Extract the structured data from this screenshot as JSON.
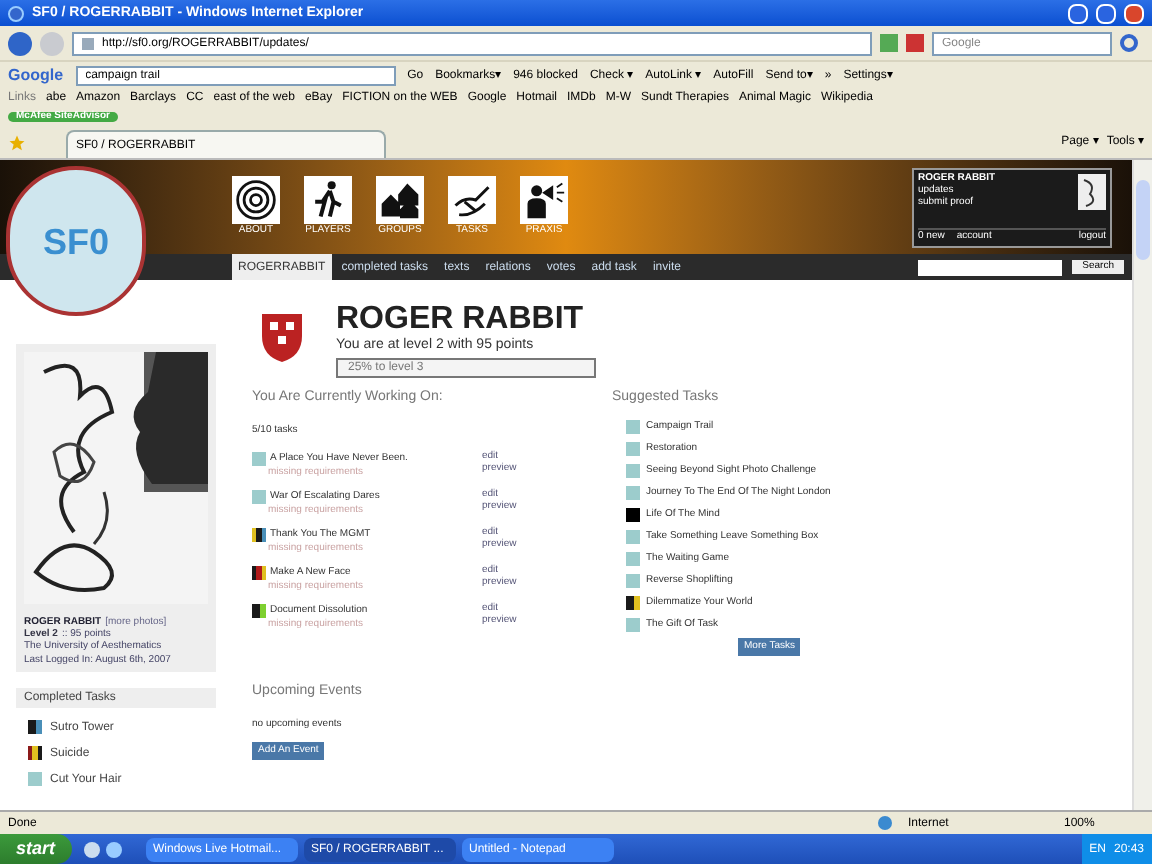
{
  "window": {
    "title": "SF0 / ROGERRABBIT - Windows Internet Explorer"
  },
  "address": {
    "url": "http://sf0.org/ROGERRABBIT/updates/",
    "search_placeholder": "Google"
  },
  "google_toolbar": {
    "brand": "Google",
    "query": "campaign trail",
    "go": "Go",
    "items": [
      "Bookmarks▾",
      "946 blocked",
      "Check ▾",
      "AutoLink ▾",
      "AutoFill",
      "Send to▾",
      "»",
      "Settings▾"
    ]
  },
  "links_bar": {
    "label": "Links",
    "links": [
      "abe",
      "Amazon",
      "Barclays",
      "CC",
      "east of the web",
      "eBay",
      "FICTION on the WEB",
      "Google",
      "Hotmail",
      "IMDb",
      "M-W",
      "Sundt Therapies",
      "Animal Magic",
      "Wikipedia"
    ]
  },
  "mcafee": {
    "label": "McAfee SiteAdvisor"
  },
  "tab": {
    "title": "SF0 / ROGERRABBIT"
  },
  "command_bar": {
    "items": [
      "Page ▾",
      "Tools ▾"
    ]
  },
  "site": {
    "logo": "SF0",
    "sections": [
      {
        "label": "ABOUT",
        "kind": "target"
      },
      {
        "label": "PLAYERS",
        "kind": "runner"
      },
      {
        "label": "GROUPS",
        "kind": "houses"
      },
      {
        "label": "TASKS",
        "kind": "hand"
      },
      {
        "label": "PRAXIS",
        "kind": "megaphone"
      }
    ],
    "user_box": {
      "name": "ROGER RABBIT",
      "links": [
        "updates",
        "submit proof"
      ],
      "messages": "0 new",
      "account": "account",
      "logout": "logout"
    },
    "nav": [
      {
        "label": "ROGERRABBIT",
        "selected": true
      },
      {
        "label": "completed tasks",
        "selected": false
      },
      {
        "label": "texts",
        "selected": false
      },
      {
        "label": "relations",
        "selected": false
      },
      {
        "label": "votes",
        "selected": false
      },
      {
        "label": "add task",
        "selected": false
      },
      {
        "label": "invite",
        "selected": false
      }
    ],
    "search_button": "Search"
  },
  "profile": {
    "more_photos": "[more photos]",
    "name": "ROGER RABBIT",
    "level": "Level 2",
    "points": ":: 95 points",
    "school": "The University of Aesthematics",
    "last_logged_label": "Last Logged In:",
    "last_logged": "August 6th, 2007"
  },
  "completed": {
    "title": "Completed Tasks",
    "tasks": [
      {
        "name": "Sutro Tower",
        "stripes": [
          {
            "color": "#1a1a1a"
          },
          {
            "color": "#4a8fb8"
          }
        ]
      },
      {
        "name": "Suicide",
        "stripes": [
          {
            "color": "#8b1a1a"
          },
          {
            "color": "#e0c020"
          },
          {
            "color": "#1a1a1a"
          }
        ]
      },
      {
        "name": "Cut Your Hair",
        "stripes": [
          {
            "color": "#9ccccc"
          }
        ]
      }
    ]
  },
  "player": {
    "name": "ROGER RABBIT",
    "status": "You are at level 2 with 95 points",
    "progress": "25% to level 3"
  },
  "working": {
    "title": "You Are Currently Working On:",
    "count": "5/10 tasks",
    "tasks": [
      {
        "name": "A Place You Have Never Been.",
        "note": "missing requirements",
        "stripes": [
          {
            "color": "#9ccccc"
          }
        ],
        "actions": [
          "edit",
          "preview"
        ]
      },
      {
        "name": "War Of Escalating Dares",
        "note": "missing requirements",
        "stripes": [
          {
            "color": "#9ccccc"
          }
        ],
        "actions": [
          "edit",
          "preview"
        ]
      },
      {
        "name": "Thank You The MGMT",
        "note": "missing requirements",
        "stripes": [
          {
            "color": "#e0c020"
          },
          {
            "color": "#1a1a1a"
          },
          {
            "color": "#4a8fb8"
          }
        ],
        "actions": [
          "edit",
          "preview"
        ]
      },
      {
        "name": "Make A New Face",
        "note": "missing requirements",
        "stripes": [
          {
            "color": "#1a1a1a"
          },
          {
            "color": "#b01a1a"
          },
          {
            "color": "#e0c020"
          }
        ],
        "actions": [
          "edit",
          "preview"
        ]
      },
      {
        "name": "Document Dissolution",
        "note": "missing requirements",
        "stripes": [
          {
            "color": "#1a1a1a"
          },
          {
            "color": "#7ed030"
          }
        ],
        "actions": [
          "edit",
          "preview"
        ]
      }
    ]
  },
  "suggested": {
    "title": "Suggested Tasks",
    "button": "More Tasks",
    "tasks": [
      {
        "name": "Campaign Trail",
        "stripes": [
          {
            "color": "#9ccccc"
          }
        ]
      },
      {
        "name": "Restoration",
        "stripes": [
          {
            "color": "#9ccccc"
          }
        ]
      },
      {
        "name": "Seeing Beyond Sight Photo Challenge",
        "stripes": [
          {
            "color": "#9ccccc"
          }
        ]
      },
      {
        "name": "Journey To The End Of The Night London",
        "stripes": [
          {
            "color": "#9ccccc"
          }
        ]
      },
      {
        "name": "Life Of The Mind",
        "stripes": [
          {
            "color": "#000000"
          }
        ]
      },
      {
        "name": "Take Something Leave Something Box",
        "stripes": [
          {
            "color": "#9ccccc"
          }
        ]
      },
      {
        "name": "The Waiting Game",
        "stripes": [
          {
            "color": "#9ccccc"
          }
        ]
      },
      {
        "name": "Reverse Shoplifting",
        "stripes": [
          {
            "color": "#9ccccc"
          }
        ]
      },
      {
        "name": "Dilemmatize Your World",
        "stripes": [
          {
            "color": "#1a1a1a"
          },
          {
            "color": "#e0c020"
          }
        ]
      },
      {
        "name": "The Gift Of Task",
        "stripes": [
          {
            "color": "#9ccccc"
          }
        ]
      }
    ]
  },
  "events": {
    "title": "Upcoming Events",
    "empty": "no upcoming events",
    "button": "Add An Event"
  },
  "status_bar": {
    "text": "Done",
    "zone": "Internet",
    "zoom": "100%"
  },
  "taskbar": {
    "start": "start",
    "windows": [
      {
        "title": "Windows Live Hotmail...",
        "selected": false
      },
      {
        "title": "SF0 / ROGERRABBIT ...",
        "selected": true
      },
      {
        "title": "Untitled - Notepad",
        "selected": false
      }
    ],
    "language": "EN",
    "clock": "20:43"
  }
}
